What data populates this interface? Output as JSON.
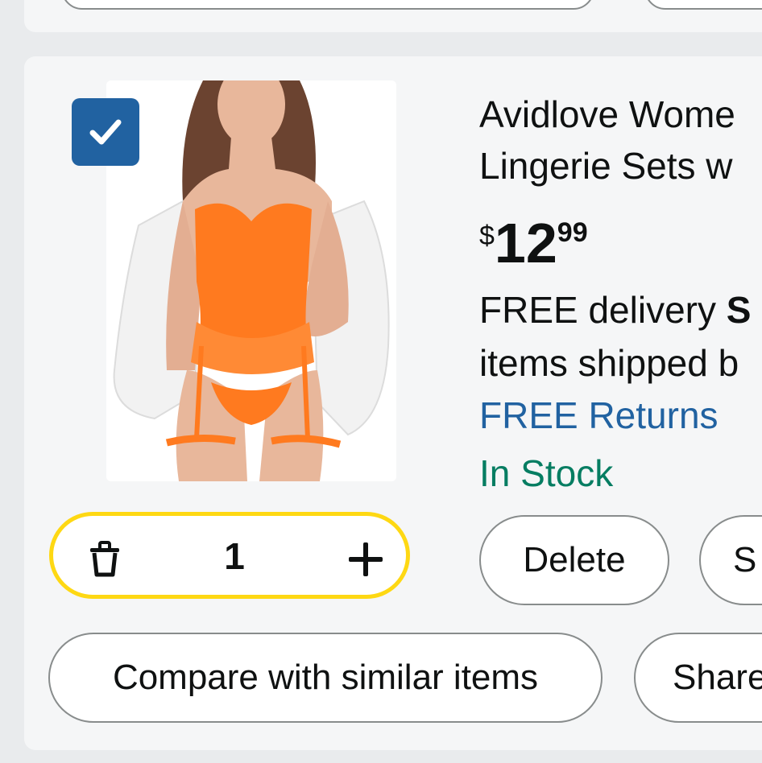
{
  "product": {
    "title_line1": "Avidlove Wome",
    "title_line2": "Lingerie Sets w",
    "price": {
      "symbol": "$",
      "whole": "12",
      "fraction": "99"
    },
    "delivery_prefix": "FREE delivery ",
    "delivery_bold": "S",
    "delivery_line2": "items shipped b",
    "returns": "FREE Returns",
    "stock": "In Stock",
    "selected": true
  },
  "quantity": {
    "value": "1"
  },
  "actions": {
    "delete": "Delete",
    "save": "S",
    "compare": "Compare with similar items",
    "share": "Share"
  },
  "colors": {
    "accent_blue": "#2162a1",
    "stepper_border": "#fed813",
    "in_stock_green": "#067d62",
    "card_bg": "#f5f6f7"
  },
  "icons": {
    "checkbox": "checkmark-icon",
    "trash": "trash-icon",
    "plus": "plus-icon"
  }
}
